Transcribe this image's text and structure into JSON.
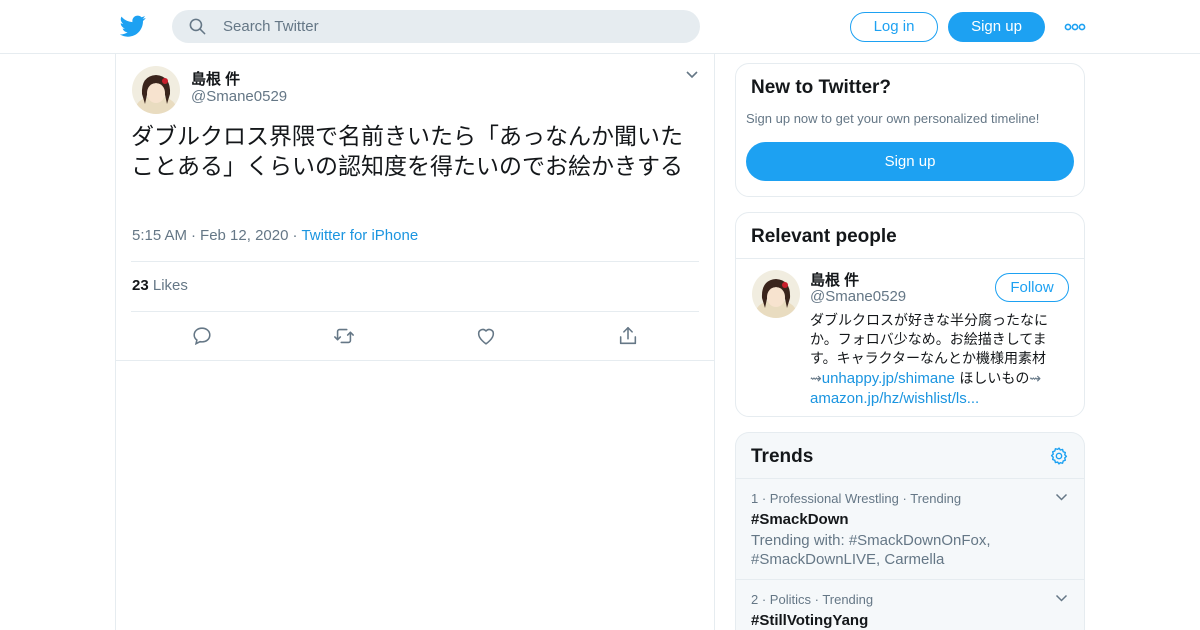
{
  "header": {
    "search_placeholder": "Search Twitter",
    "login_label": "Log in",
    "signup_label": "Sign up",
    "brand_color": "#1da1f2"
  },
  "tweet": {
    "author_name": "島根 件",
    "author_handle": "@Smane0529",
    "text": "ダブルクロス界隈で名前きいたら「あっなんか聞いたことある」くらいの認知度を得たいのでお絵かきする",
    "time": "5:15 AM",
    "date": "Feb 12, 2020",
    "source": "Twitter for iPhone",
    "likes_count": "23",
    "likes_label": "Likes"
  },
  "new_to_twitter": {
    "title": "New to Twitter?",
    "subtitle": "Sign up now to get your own personalized timeline!",
    "button_label": "Sign up"
  },
  "relevant_people": {
    "title": "Relevant people",
    "person": {
      "name": "島根 件",
      "handle": "@Smane0529",
      "follow_label": "Follow",
      "bio_text": "ダブルクロスが好きな半分腐ったなにか。フォロバ少なめ。お絵描きしてます。キャラクターなんとか機様用素材",
      "bio_link1": "unhappy.jp/shimane",
      "bio_mid": " ほしいもの",
      "bio_link2": "amazon.jp/hz/wishlist/ls..."
    }
  },
  "trends": {
    "title": "Trends",
    "items": [
      {
        "rank": "1",
        "category": "Professional Wrestling",
        "status": "Trending",
        "tag": "#SmackDown",
        "with": "Trending with: #SmackDownOnFox, #SmackDownLIVE, Carmella"
      },
      {
        "rank": "2",
        "category": "Politics",
        "status": "Trending",
        "tag": "#StillVotingYang"
      }
    ]
  }
}
